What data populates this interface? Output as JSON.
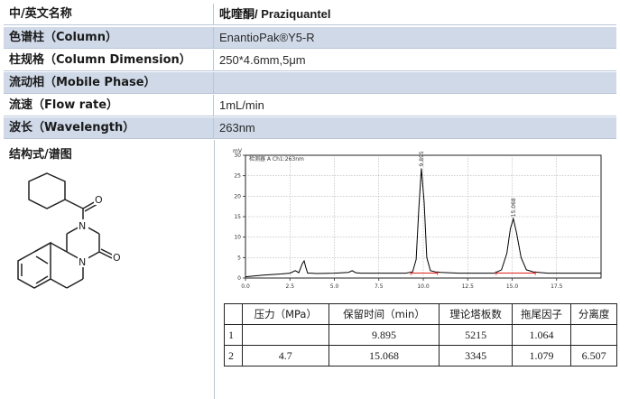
{
  "rows": [
    {
      "label": "中/英文名称",
      "value": "吡喹酮/ Praziquantel"
    },
    {
      "label": "色谱柱（Column）",
      "value": "EnantioPak®Y5-R"
    },
    {
      "label": "柱规格（Column Dimension）",
      "value": "250*4.6mm,5μm"
    },
    {
      "label": "流动相（Mobile Phase）",
      "value": ""
    },
    {
      "label": "流速（Flow rate）",
      "value": "1mL/min"
    },
    {
      "label": "波长（Wavelength）",
      "value": "263nm"
    }
  ],
  "structure_label": "结构式/谱图",
  "chart_data": {
    "type": "line",
    "title": "",
    "trace_label": "检测器 A Ch1:263nm",
    "y_unit_label": "mV",
    "xlim": [
      0,
      20
    ],
    "ylim": [
      0,
      30
    ],
    "x_ticks": [
      "0.0",
      "2.5",
      "5.0",
      "7.5",
      "10.0",
      "12.5",
      "15.0",
      "17.5"
    ],
    "x_tick_values": [
      0,
      2.5,
      5,
      7.5,
      10,
      12.5,
      15,
      17.5
    ],
    "y_ticks": [
      "0",
      "5",
      "10",
      "15",
      "20",
      "25",
      "30"
    ],
    "y_tick_values": [
      0,
      5,
      10,
      15,
      20,
      25,
      30
    ],
    "series": [
      {
        "x": [
          0.0,
          1.0,
          2.0,
          2.5,
          2.8,
          3.0,
          3.2,
          3.3,
          3.4,
          3.5,
          3.7,
          4.0,
          5.0,
          5.8,
          6.0,
          6.2,
          6.5,
          7.5,
          8.5,
          9.0,
          9.4,
          9.6,
          9.75,
          9.895,
          10.05,
          10.2,
          10.4,
          10.7,
          11.0,
          12.0,
          13.0,
          14.0,
          14.4,
          14.7,
          14.9,
          15.068,
          15.25,
          15.5,
          15.8,
          16.2,
          17.0,
          18.0,
          19.0,
          20.0
        ],
        "y": [
          0.3,
          0.7,
          1.0,
          1.2,
          1.8,
          1.3,
          3.5,
          4.2,
          2.5,
          1.2,
          1.2,
          1.1,
          1.2,
          1.4,
          1.8,
          1.3,
          1.2,
          1.2,
          1.2,
          1.2,
          1.5,
          4.5,
          17.0,
          26.8,
          18.5,
          5.0,
          1.8,
          1.5,
          1.4,
          1.2,
          1.2,
          1.2,
          2.0,
          6.0,
          12.0,
          14.5,
          11.0,
          5.0,
          2.0,
          1.5,
          1.2,
          1.2,
          1.2,
          1.2
        ]
      }
    ],
    "peaks": [
      {
        "rt": 9.895,
        "label": "9.895",
        "height": 26.8
      },
      {
        "rt": 15.068,
        "label": "15.068",
        "height": 14.5
      }
    ],
    "baseline_marks": [
      {
        "from": 9.3,
        "to": 10.8
      },
      {
        "from": 14.1,
        "to": 16.3
      }
    ]
  },
  "results": {
    "headers": [
      "",
      "压力（MPa）",
      "保留时间（min）",
      "理论塔板数",
      "拖尾因子",
      "分离度"
    ],
    "rows": [
      [
        "1",
        "",
        "9.895",
        "5215",
        "1.064",
        ""
      ],
      [
        "2",
        "4.7",
        "15.068",
        "3345",
        "1.079",
        "6.507"
      ]
    ]
  },
  "colors": {
    "shade": "#cfd9e8",
    "trace": "#000000",
    "baseline_mark": "#e0201a",
    "grid": "#a0a0a0"
  }
}
